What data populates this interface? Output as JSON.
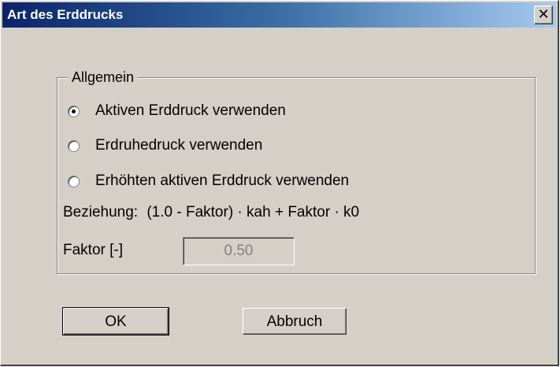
{
  "window": {
    "title": "Art des Erddrucks",
    "close_symbol": "✕"
  },
  "group": {
    "legend": "Allgemein",
    "options": [
      {
        "label": "Aktiven Erddruck verwenden",
        "checked": true
      },
      {
        "label": "Erdruhedruck verwenden",
        "checked": false
      },
      {
        "label": "Erhöhten aktiven Erddruck verwenden",
        "checked": false
      }
    ],
    "relation_label": "Beziehung:",
    "relation_formula": "(1.0 - Faktor) · kah + Faktor · k0",
    "factor_label": "Faktor [-]",
    "factor_value": "0.50"
  },
  "buttons": {
    "ok": "OK",
    "cancel": "Abbruch"
  }
}
